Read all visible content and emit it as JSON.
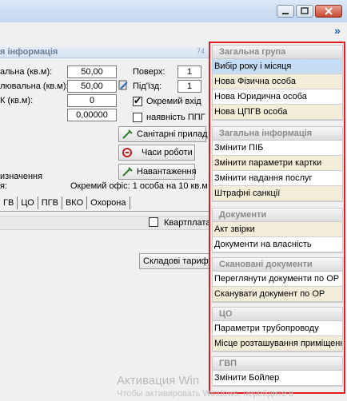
{
  "window": {
    "controls": [
      "minimize-icon",
      "maximize-icon",
      "close-icon"
    ]
  },
  "panel": {
    "header": "я інформація",
    "counter": "74"
  },
  "fields": {
    "area_label": "альна (кв.м):",
    "area_value": "50,00",
    "heated_label": "лювальна (кв.м):",
    "heated_value": "50,00",
    "k_label": "К (кв.м):",
    "k_value": "0",
    "extra_value": "0,00000",
    "floor_label": "Поверх:",
    "floor_value": "1",
    "entrance_label": "Під'їзд:",
    "entrance_value": "1",
    "separate_entry_label": "Окремий вхід",
    "separate_entry_checked": true,
    "ppf_label": "наявність ППГ",
    "ppf_checked": false
  },
  "buttons": {
    "sanitary": "Санітарні прилад",
    "hours": "Часи роботи",
    "load": "Навантаження"
  },
  "info": {
    "line1": "изначення",
    "line2": "я:",
    "office": "Окремий офіс: 1 особа на 10 кв.м"
  },
  "tabs": [
    "ГВ",
    "ЦО",
    "ПГВ",
    "ВКО",
    "Охорона"
  ],
  "quarterly_label": "Квартплата",
  "tariff_button": "Складові тарифу",
  "sidebar": {
    "groups": [
      {
        "title": "Загальна група",
        "items": [
          "Вибір року і місяця",
          "Нова Фізична особа",
          "Нова Юридична особа",
          "Нова ЦПГВ особа"
        ]
      },
      {
        "title": "Загальна інформація",
        "items": [
          "Змінити ПІБ",
          "Змінити параметри картки",
          "Змінити надання послуг",
          "Штрафні санкції"
        ]
      },
      {
        "title": "Документи",
        "items": [
          "Акт звірки",
          "Документи на власність"
        ]
      },
      {
        "title": "Скановані документи",
        "items": [
          "Переглянути документи по ОР",
          "Сканувати документ по ОР"
        ]
      },
      {
        "title": "ЦО",
        "items": [
          "Параметри трубопроводу",
          "Місце розташування приміщення"
        ]
      },
      {
        "title": "ГВП",
        "items": [
          "Змінити Бойлер"
        ]
      }
    ]
  },
  "watermark": {
    "line1": "Активация Win",
    "line2": "Чтобы активировать Windows, перейдите в"
  }
}
